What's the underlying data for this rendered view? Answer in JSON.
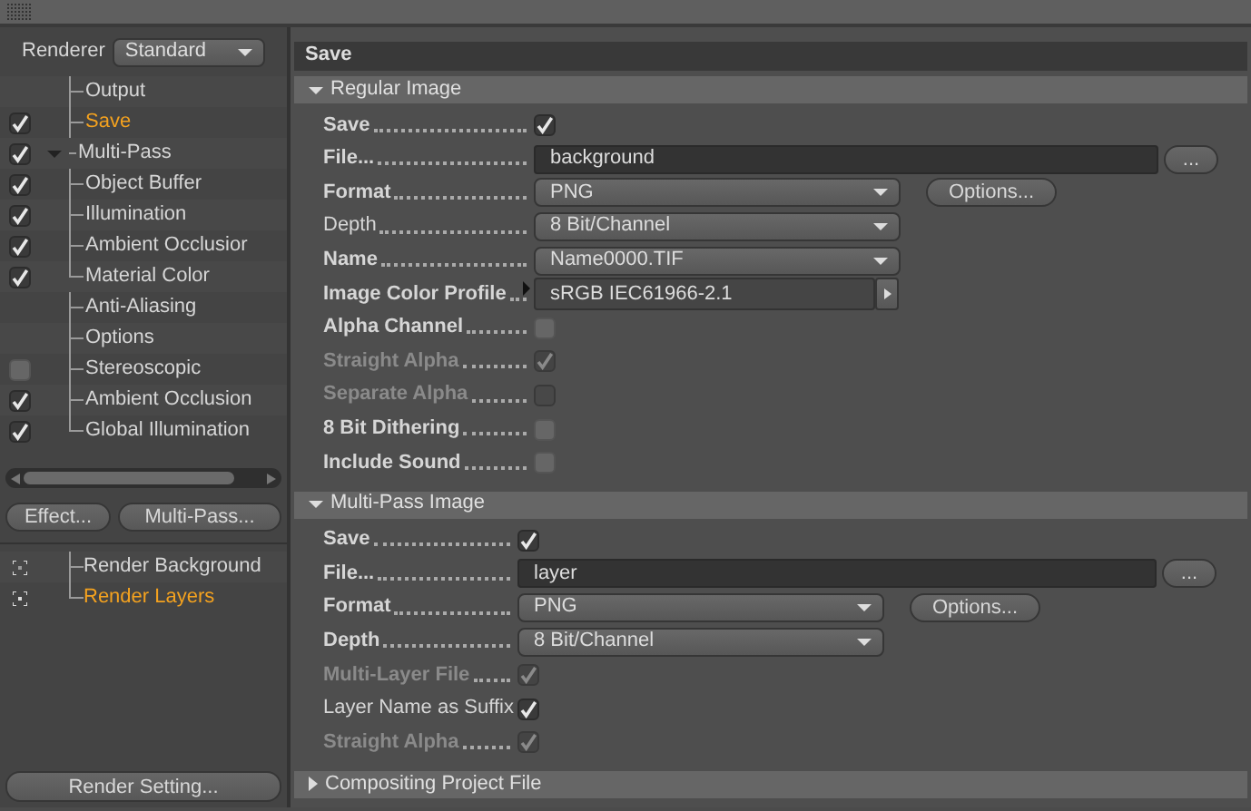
{
  "renderer": {
    "label": "Renderer",
    "value": "Standard"
  },
  "tree": [
    {
      "label": "Output",
      "kind": "plain",
      "selected": false
    },
    {
      "label": "Save",
      "kind": "checkbox",
      "checked": true,
      "selected": true
    },
    {
      "label": "Multi-Pass",
      "kind": "checkbox",
      "checked": true,
      "selected": false,
      "expanded": true,
      "children": [
        {
          "label": "Object Buffer",
          "kind": "checkbox",
          "checked": true,
          "selected": false
        },
        {
          "label": "Illumination",
          "kind": "checkbox",
          "checked": true,
          "selected": false
        },
        {
          "label": "Ambient Occlusior",
          "kind": "checkbox",
          "checked": true,
          "selected": false
        },
        {
          "label": "Material Color",
          "kind": "checkbox",
          "checked": true,
          "selected": false
        }
      ]
    },
    {
      "label": "Anti-Aliasing",
      "kind": "plain",
      "selected": false
    },
    {
      "label": "Options",
      "kind": "plain",
      "selected": false
    },
    {
      "label": "Stereoscopic",
      "kind": "checkbox",
      "checked": false,
      "selected": false
    },
    {
      "label": "Ambient Occlusion",
      "kind": "checkbox",
      "checked": true,
      "selected": false
    },
    {
      "label": "Global Illumination",
      "kind": "checkbox",
      "checked": true,
      "selected": false
    }
  ],
  "left_buttons": [
    "Effect...",
    "Multi-Pass..."
  ],
  "layers": [
    {
      "label": "Render Background",
      "selected": false
    },
    {
      "label": "Render Layers",
      "selected": true
    }
  ],
  "bottom_button": "Render Setting...",
  "panel_title": "Save",
  "sections": [
    {
      "title": "Regular Image",
      "expanded": true,
      "rows": [
        {
          "kind": "checkbox",
          "label": "Save",
          "bold": true,
          "disabled": false,
          "checked": true
        },
        {
          "kind": "file",
          "label": "File...",
          "bold": true,
          "value": "background",
          "button": "..."
        },
        {
          "kind": "dropdown",
          "label": "Format",
          "bold": true,
          "value": "PNG",
          "button": "Options..."
        },
        {
          "kind": "dropdown",
          "label": "Depth",
          "bold": false,
          "value": "8 Bit/Channel"
        },
        {
          "kind": "dropdown",
          "label": "Name",
          "bold": true,
          "value": "Name0000.TIF"
        },
        {
          "kind": "profile",
          "label": "Image Color Profile",
          "bold": true,
          "value": "sRGB IEC61966-2.1"
        },
        {
          "kind": "checkbox",
          "label": "Alpha Channel",
          "bold": true,
          "disabled": false,
          "checked": false
        },
        {
          "kind": "checkbox",
          "label": "Straight Alpha",
          "bold": true,
          "disabled": true,
          "checked": true
        },
        {
          "kind": "checkbox",
          "label": "Separate Alpha",
          "bold": true,
          "disabled": true,
          "checked": false
        },
        {
          "kind": "checkbox",
          "label": "8 Bit Dithering",
          "bold": true,
          "disabled": false,
          "checked": false
        },
        {
          "kind": "checkbox",
          "label": "Include Sound",
          "bold": true,
          "disabled": false,
          "checked": false
        }
      ]
    },
    {
      "title": "Multi-Pass Image",
      "expanded": true,
      "rows": [
        {
          "kind": "checkbox",
          "label": "Save",
          "bold": true,
          "disabled": false,
          "checked": true
        },
        {
          "kind": "file",
          "label": "File...",
          "bold": true,
          "value": "layer",
          "button": "..."
        },
        {
          "kind": "dropdown",
          "label": "Format",
          "bold": true,
          "value": "PNG",
          "button": "Options..."
        },
        {
          "kind": "dropdown",
          "label": "Depth",
          "bold": true,
          "value": "8 Bit/Channel"
        },
        {
          "kind": "checkbox",
          "label": "Multi-Layer File",
          "bold": true,
          "disabled": true,
          "checked": true
        },
        {
          "kind": "checkbox",
          "label": "Layer Name as Suffix",
          "bold": false,
          "disabled": false,
          "checked": true
        },
        {
          "kind": "checkbox",
          "label": "Straight Alpha",
          "bold": true,
          "disabled": true,
          "checked": true
        }
      ]
    },
    {
      "title": "Compositing Project File",
      "expanded": false
    }
  ]
}
